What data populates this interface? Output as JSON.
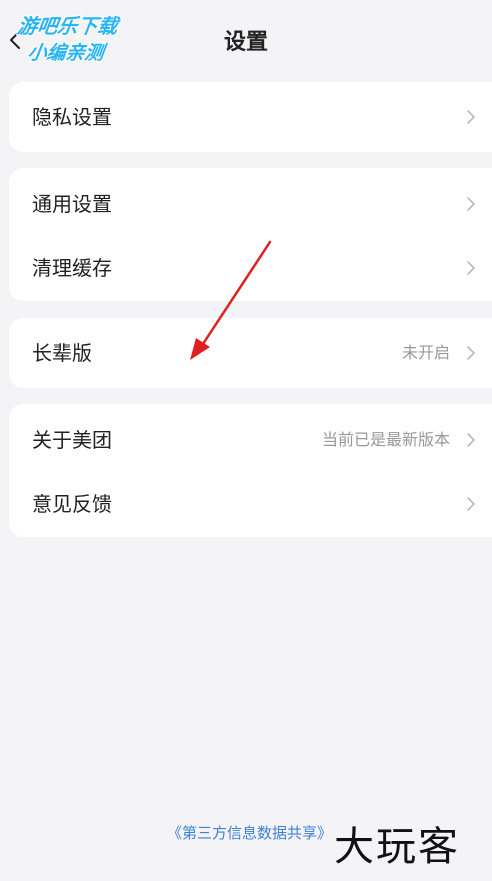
{
  "header": {
    "title": "设置",
    "watermark": {
      "line1": "游吧乐下载",
      "line2": "小编亲测"
    }
  },
  "groups": [
    {
      "items": [
        {
          "label": "隐私设置",
          "value": ""
        }
      ]
    },
    {
      "items": [
        {
          "label": "通用设置",
          "value": ""
        },
        {
          "label": "清理缓存",
          "value": ""
        }
      ]
    },
    {
      "items": [
        {
          "label": "长辈版",
          "value": "未开启"
        }
      ]
    },
    {
      "items": [
        {
          "label": "关于美团",
          "value": "当前已是最新版本"
        },
        {
          "label": "意见反馈",
          "value": ""
        }
      ]
    }
  ],
  "footer": {
    "link": "《第三方信息数据共享》"
  },
  "brand_watermark": "大玩客",
  "colors": {
    "background": "#f4f4f7",
    "card": "#ffffff",
    "link": "#3d7fd9",
    "watermark": "#29b4f6",
    "annotation_arrow": "#e02020"
  },
  "icons": {
    "back": "chevron-left-icon",
    "row": "chevron-right-icon"
  }
}
